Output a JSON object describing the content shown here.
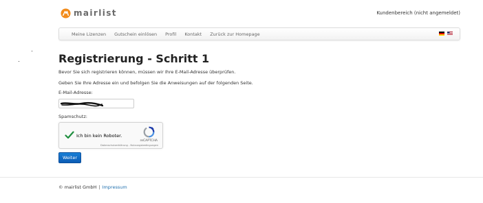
{
  "header": {
    "logo_text": "mairlist",
    "account_link": "Kundenbereich (nicht angemeldet)"
  },
  "nav": {
    "items": [
      {
        "label": "Meine Lizenzen"
      },
      {
        "label": "Gutschein einlösen"
      },
      {
        "label": "Profil"
      },
      {
        "label": "Kontakt"
      },
      {
        "label": "Zurück zur Homepage"
      }
    ],
    "flags": [
      {
        "icon": "flag-germany-icon",
        "colors": [
          "#000000",
          "#dd0000",
          "#ffce00"
        ]
      },
      {
        "icon": "flag-usa-icon",
        "colors": [
          "#b22234",
          "#ffffff",
          "#3c3b6e"
        ]
      }
    ]
  },
  "main": {
    "title": "Registrierung - Schritt 1",
    "intro": "Bevor Sie sich registrieren können, müssen wir Ihre E-Mail-Adresse überprüfen.",
    "instructions": "Geben Sie Ihre Adresse ein und befolgen Sie die Anweisungen auf der folgenden Seite.",
    "email_label": "E-Mail-Adresse:",
    "email_value": "",
    "spam_label": "Spamschutz:",
    "captcha": {
      "label": "Ich bin kein Roboter.",
      "brand": "reCAPTCHA",
      "terms": "Datenschutzerklärung - Nutzungsbedingungen",
      "checked": true,
      "check_color": "#1e8e3e"
    },
    "submit_label": "Weiter"
  },
  "footer": {
    "copyright": "© mairlist GmbH",
    "separator": "|",
    "impressum": "Impressum"
  },
  "colors": {
    "brand_orange": "#f28c1c",
    "primary_button": "#0b6ac8",
    "link": "#1f6fae"
  }
}
